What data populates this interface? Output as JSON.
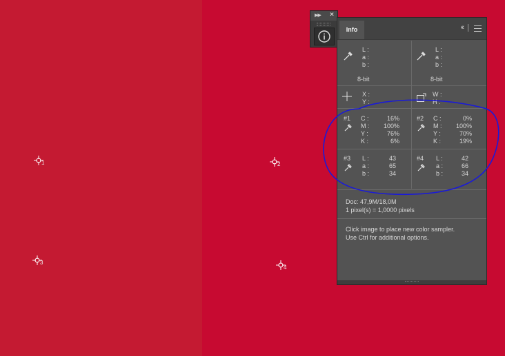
{
  "canvas": {
    "left_color": "#c41a32",
    "right_color": "#c70a31"
  },
  "samplers": [
    {
      "num": "1"
    },
    {
      "num": "2"
    },
    {
      "num": "3"
    },
    {
      "num": "4"
    }
  ],
  "dock": {
    "collapse_icon": "double-arrow-right-icon",
    "close_icon": "close-icon",
    "button_icon": "info-icon"
  },
  "panel": {
    "tab": "Info",
    "collapse_icon": "double-chevron-left-icon",
    "menu_icon": "hamburger-menu-icon",
    "readout_left": {
      "L": "L :",
      "a": "a :",
      "b": "b :",
      "depth": "8-bit"
    },
    "readout_right": {
      "L": "L :",
      "a": "a :",
      "b": "b :",
      "depth": "8-bit"
    },
    "position": {
      "x": "X :",
      "y": "Y :"
    },
    "size": {
      "w": "W :",
      "h": "H :"
    },
    "samples": [
      {
        "tag": "#1",
        "labels": [
          "C :",
          "M :",
          "Y :",
          "K :"
        ],
        "values": [
          "16%",
          "100%",
          "76%",
          "6%"
        ]
      },
      {
        "tag": "#2",
        "labels": [
          "C :",
          "M :",
          "Y :",
          "K :"
        ],
        "values": [
          "0%",
          "100%",
          "70%",
          "19%"
        ]
      },
      {
        "tag": "#3",
        "labels": [
          "L :",
          "a :",
          "b :"
        ],
        "values": [
          "43",
          "65",
          "34"
        ]
      },
      {
        "tag": "#4",
        "labels": [
          "L :",
          "a :",
          "b :"
        ],
        "values": [
          "42",
          "66",
          "34"
        ]
      }
    ],
    "doc": "Doc: 47,9M/18,0M",
    "scale": "1 pixel(s) = 1,0000 pixels",
    "hint1": "Click image to place new color sampler.",
    "hint2": "Use Ctrl for additional options."
  },
  "annotation": {
    "color": "#1a1ad8"
  }
}
